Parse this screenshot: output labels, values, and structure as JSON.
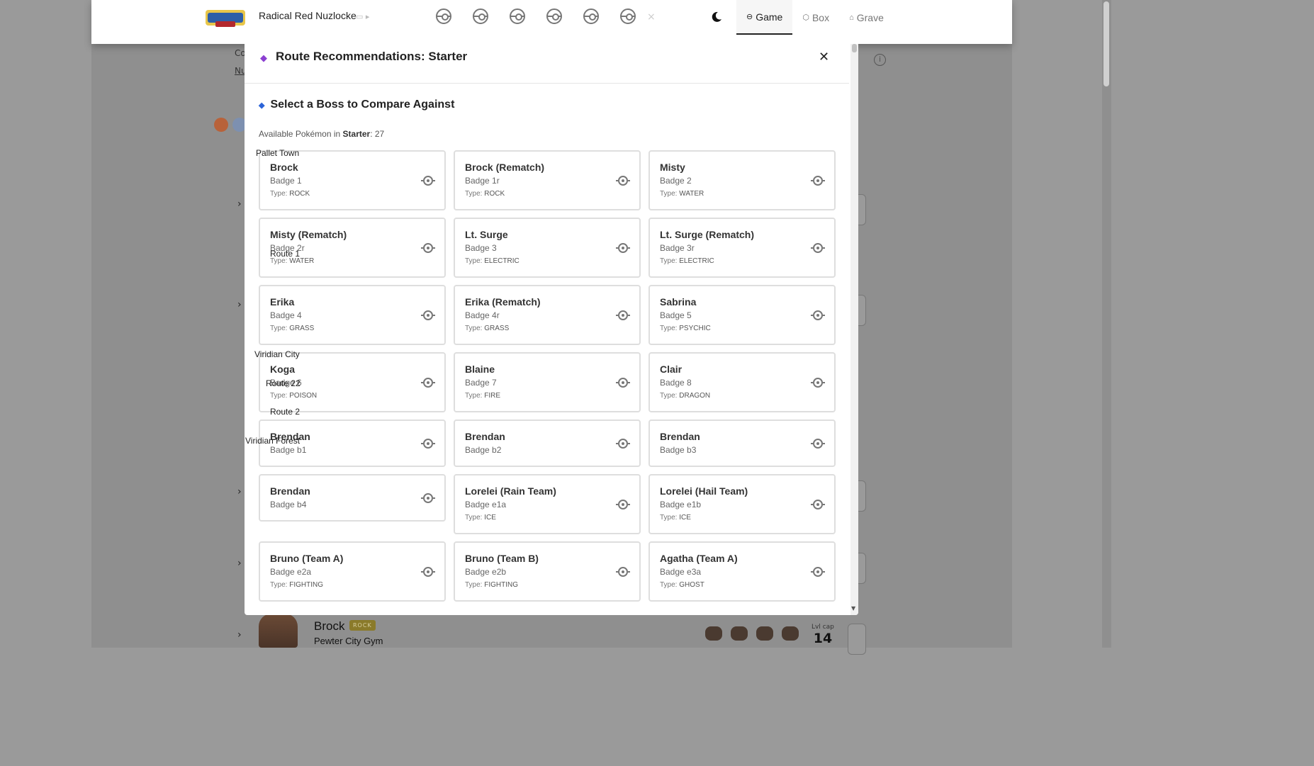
{
  "header": {
    "game_title": "Radical Red Nuzlocke",
    "tabs": [
      {
        "label": "Game",
        "icon": "gamepad-icon"
      },
      {
        "label": "Box",
        "icon": "box-icon"
      },
      {
        "label": "Grave",
        "icon": "grave-icon"
      }
    ]
  },
  "modal": {
    "title": "Route Recommendations: Starter",
    "section_title": "Select a Boss to Compare Against",
    "available_prefix": "Available Pokémon in ",
    "available_location": "Starter",
    "available_count": ": 27",
    "type_prefix": "Type: ",
    "bosses": [
      {
        "name": "Brock",
        "badge": "Badge 1",
        "type": "ROCK"
      },
      {
        "name": "Brock (Rematch)",
        "badge": "Badge 1r",
        "type": "ROCK"
      },
      {
        "name": "Misty",
        "badge": "Badge 2",
        "type": "WATER"
      },
      {
        "name": "Misty (Rematch)",
        "badge": "Badge 2r",
        "type": "WATER"
      },
      {
        "name": "Lt. Surge",
        "badge": "Badge 3",
        "type": "ELECTRIC"
      },
      {
        "name": "Lt. Surge (Rematch)",
        "badge": "Badge 3r",
        "type": "ELECTRIC"
      },
      {
        "name": "Erika",
        "badge": "Badge 4",
        "type": "GRASS"
      },
      {
        "name": "Erika (Rematch)",
        "badge": "Badge 4r",
        "type": "GRASS"
      },
      {
        "name": "Sabrina",
        "badge": "Badge 5",
        "type": "PSYCHIC"
      },
      {
        "name": "Koga",
        "badge": "Badge 6",
        "type": "POISON"
      },
      {
        "name": "Blaine",
        "badge": "Badge 7",
        "type": "FIRE"
      },
      {
        "name": "Clair",
        "badge": "Badge 8",
        "type": "DRAGON"
      },
      {
        "name": "Brendan",
        "badge": "Badge b1",
        "type": ""
      },
      {
        "name": "Brendan",
        "badge": "Badge b2",
        "type": ""
      },
      {
        "name": "Brendan",
        "badge": "Badge b3",
        "type": ""
      },
      {
        "name": "Brendan",
        "badge": "Badge b4",
        "type": ""
      },
      {
        "name": "Lorelei (Rain Team)",
        "badge": "Badge e1a",
        "type": "ICE"
      },
      {
        "name": "Lorelei (Hail Team)",
        "badge": "Badge e1b",
        "type": "ICE"
      },
      {
        "name": "Bruno (Team A)",
        "badge": "Badge e2a",
        "type": "FIGHTING"
      },
      {
        "name": "Bruno (Team B)",
        "badge": "Badge e2b",
        "type": "FIGHTING"
      },
      {
        "name": "Agatha (Team A)",
        "badge": "Badge e3a",
        "type": "GHOST"
      }
    ]
  },
  "route_labels": [
    "Pallet Town",
    "Route 1",
    "Viridian City",
    "Route 22",
    "Route 2",
    "Viridian Forest"
  ],
  "background": {
    "boss_name": "Brock",
    "boss_type": "ROCK",
    "boss_location": "Pewter City Gym",
    "lvl_cap_label": "Lvl cap",
    "lvl_cap_value": "14",
    "partial_label_1": "Co",
    "partial_label_2": "Nu"
  },
  "colors": {
    "accent_purple": "#8b3fd1",
    "accent_blue": "#2c64d8",
    "rock_badge": "#8a7a2a"
  }
}
